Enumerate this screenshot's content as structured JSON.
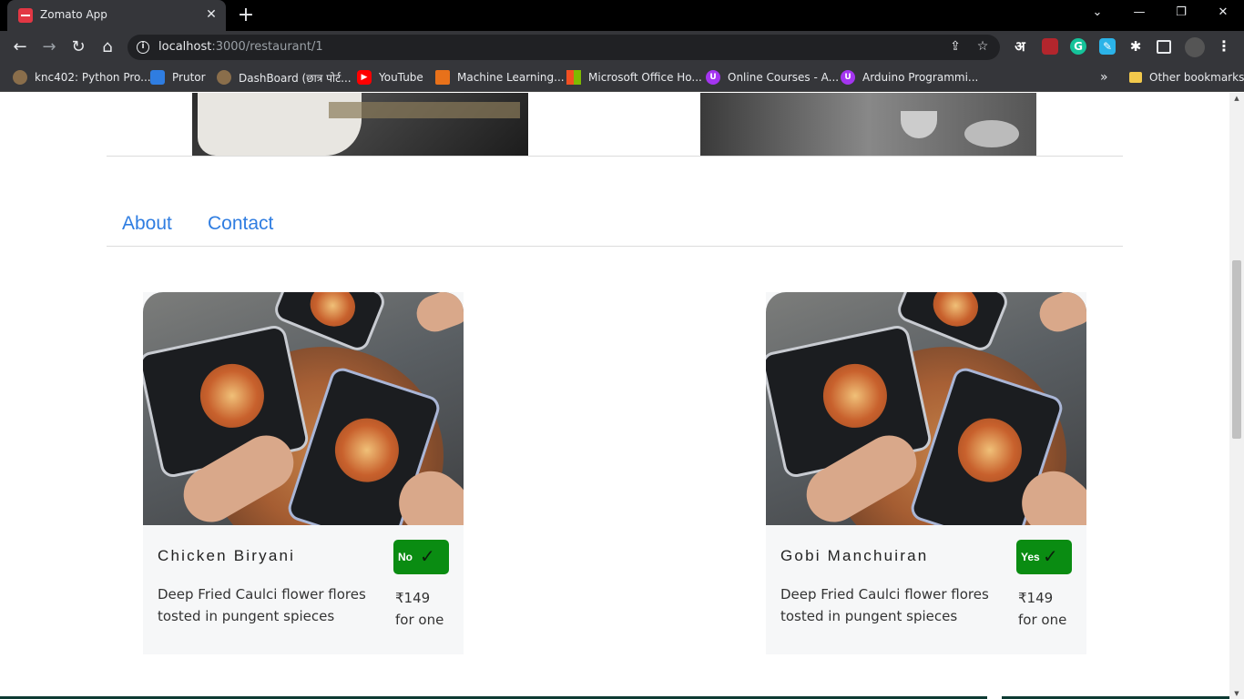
{
  "browser": {
    "tab_title": "Zomato App",
    "url_host": "localhost",
    "url_path": ":3000/restaurant/1",
    "bookmarks": [
      {
        "label": "knc402: Python Pro...",
        "icon": "globe-icon",
        "color": "#8a6e4b"
      },
      {
        "label": "Prutor",
        "icon": "prutor-icon",
        "color": "#2f7de1"
      },
      {
        "label": "DashBoard (छात्र पोर्ट...",
        "icon": "globe-icon",
        "color": "#8a6e4b"
      },
      {
        "label": "YouTube",
        "icon": "youtube-icon",
        "color": "#ff0000"
      },
      {
        "label": "Machine Learning...",
        "icon": "matlab-icon",
        "color": "#e8711a"
      },
      {
        "label": "Microsoft Office Ho...",
        "icon": "microsoft-icon",
        "color": "#f25022"
      },
      {
        "label": "Online Courses - A...",
        "icon": "udemy-icon",
        "color": "#a435f0"
      },
      {
        "label": "Arduino Programmi...",
        "icon": "udemy-icon",
        "color": "#a435f0"
      }
    ],
    "overflow": "»",
    "other_bookmarks": "Other bookmarks",
    "ext_lang": "अ"
  },
  "nav": {
    "about": "About",
    "contact": "Contact"
  },
  "dishes": [
    {
      "name": "Chicken Biryani",
      "veg_label": "No",
      "description": "Deep Fried Caulci flower flores tosted in pungent spieces",
      "price": "₹149",
      "price_unit": "for one"
    },
    {
      "name": "Gobi Manchuiran",
      "veg_label": "Yes",
      "description": "Deep Fried Caulci flower flores tosted in pungent spieces",
      "price": "₹149",
      "price_unit": "for one"
    }
  ],
  "colors": {
    "link": "#2f7de1",
    "badge": "#0a8c12",
    "card_bg": "#f6f7f8"
  }
}
